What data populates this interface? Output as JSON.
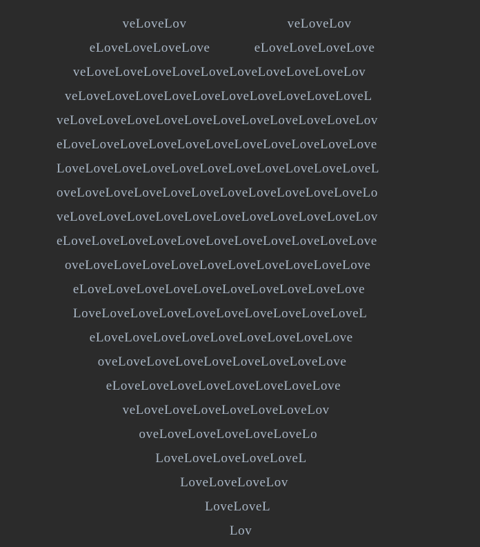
{
  "rows": [
    {
      "segments": [
        {
          "text": "veLoveLov",
          "start": 8
        },
        {
          "text": "veLoveLov",
          "start": 28
        }
      ]
    },
    {
      "segments": [
        {
          "text": "eLoveLoveLoveLove",
          "start": 4
        },
        {
          "text": "eLoveLoveLoveLove",
          "start": 24
        }
      ]
    },
    {
      "segments": [
        {
          "text": "veLoveLoveLoveLoveLoveLoveLoveLoveLoveLov",
          "start": 2
        }
      ]
    },
    {
      "segments": [
        {
          "text": "veLoveLoveLoveLoveLoveLoveLoveLoveLoveLoveL",
          "start": 1
        }
      ]
    },
    {
      "segments": [
        {
          "text": "veLoveLoveLoveLoveLoveLoveLoveLoveLoveLoveLov",
          "start": 0
        }
      ]
    },
    {
      "segments": [
        {
          "text": "eLoveLoveLoveLoveLoveLoveLoveLoveLoveLoveLove",
          "start": 0
        }
      ]
    },
    {
      "segments": [
        {
          "text": "LoveLoveLoveLoveLoveLoveLoveLoveLoveLoveLoveL",
          "start": 0
        }
      ]
    },
    {
      "segments": [
        {
          "text": "oveLoveLoveLoveLoveLoveLoveLoveLoveLoveLoveLo",
          "start": 0
        }
      ]
    },
    {
      "segments": [
        {
          "text": "veLoveLoveLoveLoveLoveLoveLoveLoveLoveLoveLov",
          "start": 0
        }
      ]
    },
    {
      "segments": [
        {
          "text": "eLoveLoveLoveLoveLoveLoveLoveLoveLoveLoveLove",
          "start": 0
        }
      ]
    },
    {
      "segments": [
        {
          "text": "oveLoveLoveLoveLoveLoveLoveLoveLoveLoveLove",
          "start": 1
        }
      ]
    },
    {
      "segments": [
        {
          "text": "eLoveLoveLoveLoveLoveLoveLoveLoveLoveLove",
          "start": 2
        }
      ]
    },
    {
      "segments": [
        {
          "text": "LoveLoveLoveLoveLoveLoveLoveLoveLoveLoveL",
          "start": 2
        }
      ]
    },
    {
      "segments": [
        {
          "text": "eLoveLoveLoveLoveLoveLoveLoveLoveLove",
          "start": 4
        }
      ]
    },
    {
      "segments": [
        {
          "text": "oveLoveLoveLoveLoveLoveLoveLoveLove",
          "start": 5
        }
      ]
    },
    {
      "segments": [
        {
          "text": "eLoveLoveLoveLoveLoveLoveLoveLove",
          "start": 6
        }
      ]
    },
    {
      "segments": [
        {
          "text": "veLoveLoveLoveLoveLoveLoveLov",
          "start": 8
        }
      ]
    },
    {
      "segments": [
        {
          "text": "oveLoveLoveLoveLoveLoveLo",
          "start": 10
        }
      ]
    },
    {
      "segments": [
        {
          "text": "LoveLoveLoveLoveLoveL",
          "start": 12
        }
      ]
    },
    {
      "segments": [
        {
          "text": "LoveLoveLoveLov",
          "start": 15
        }
      ]
    },
    {
      "segments": [
        {
          "text": "LoveLoveL",
          "start": 18
        }
      ]
    },
    {
      "segments": [
        {
          "text": "Lov",
          "start": 21
        }
      ]
    }
  ]
}
